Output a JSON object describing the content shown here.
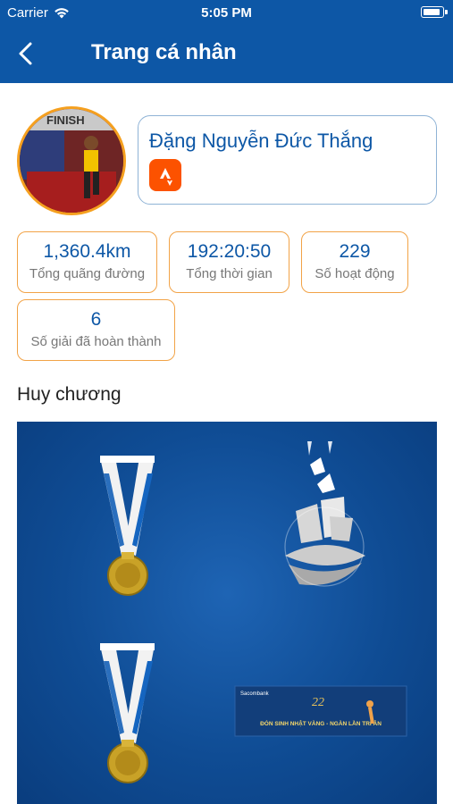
{
  "status_bar": {
    "carrier": "Carrier",
    "time": "5:05 PM"
  },
  "header": {
    "title": "Trang cá nhân"
  },
  "profile": {
    "name": "Đặng Nguyễn Đức Thắng",
    "avatar_sign_text": "FINISH"
  },
  "stats": [
    {
      "value": "1,360.4km",
      "label": "Tổng quãng đường"
    },
    {
      "value": "192:20:50",
      "label": "Tổng thời gian"
    },
    {
      "value": "229",
      "label": "Số hoạt động"
    },
    {
      "value": "6",
      "label": "Số giải đã hoàn thành"
    }
  ],
  "medals": {
    "heading": "Huy chương",
    "banner_text": "ĐÓN SINH NHẬT VÀNG - NGÀN LẦN TRI ÂN",
    "banner_brand": "Sacombank",
    "banner_number": "22"
  },
  "colors": {
    "primary": "#0d57a6",
    "accent": "#f2a347",
    "strava": "#fc5200"
  }
}
